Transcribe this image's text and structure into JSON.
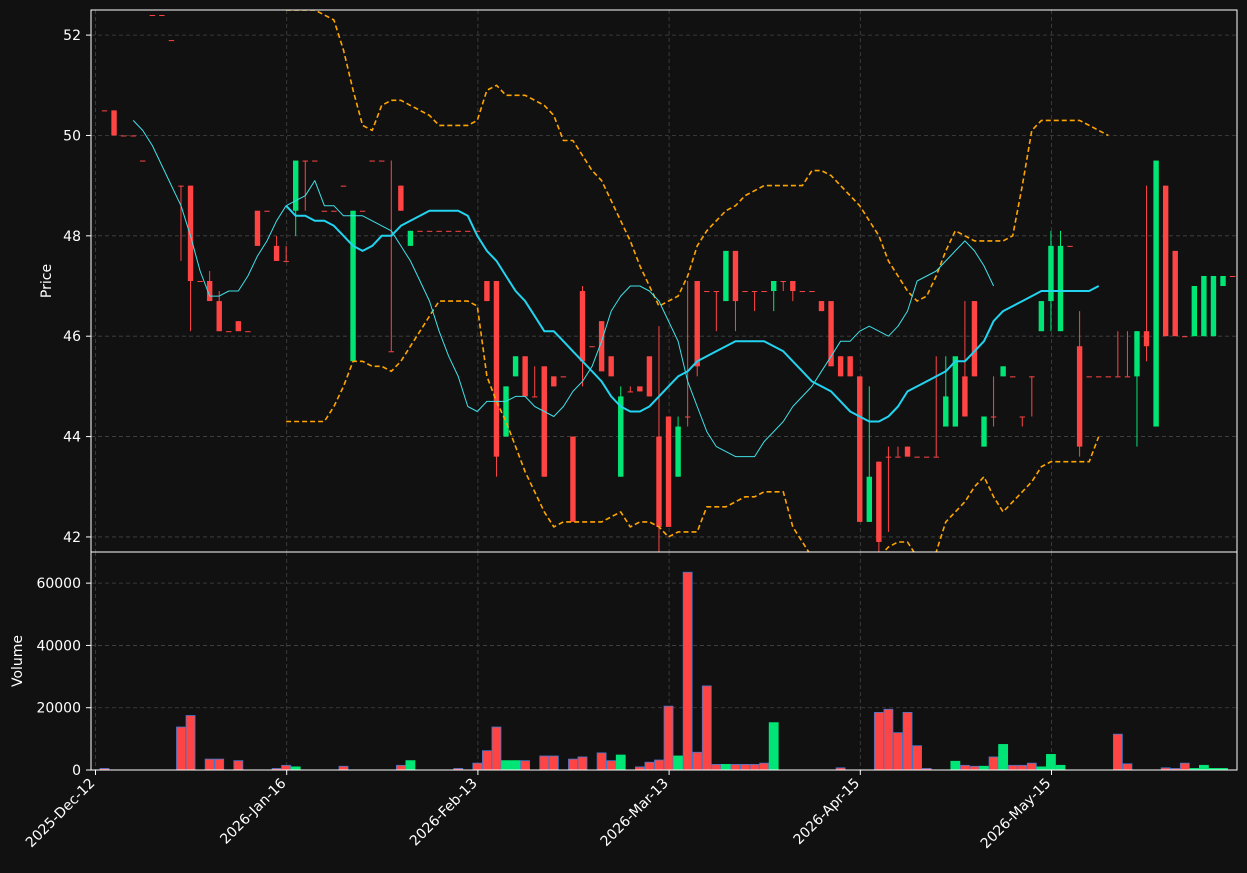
{
  "chart_data": {
    "type": "candlestick",
    "price_axis": {
      "label": "Price",
      "ylim": [
        41.7,
        52.5
      ],
      "ticks": [
        42,
        44,
        46,
        48,
        50,
        52
      ]
    },
    "volume_axis": {
      "label": "Volume",
      "ylim": [
        0,
        70000
      ],
      "ticks": [
        0,
        20000,
        40000,
        60000
      ]
    },
    "x_tick_labels": [
      "2025-Dec-12",
      "2026-Jan-16",
      "2026-Feb-13",
      "2026-Mar-13",
      "2026-Apr-15",
      "2026-May-15"
    ],
    "x_tick_index": [
      0,
      20,
      40,
      60,
      80,
      100
    ],
    "grid": true,
    "colors": {
      "background": "#111111",
      "up": "#00e676",
      "down": "#ff4444",
      "bollinger": "#ffa500",
      "ma_fast": "#40e0e8",
      "ma_slow": "#22d4f0",
      "volume_edge": "#4477cc"
    },
    "series": [
      {
        "name": "Candles",
        "open": [
          50.5,
          50.5,
          50.0,
          50.0,
          49.5,
          52.4,
          52.4,
          51.9,
          49.0,
          49.0,
          47.1,
          47.1,
          46.7,
          46.1,
          46.3,
          46.1,
          48.5,
          48.5,
          47.8,
          47.5,
          48.5,
          49.5,
          49.5,
          48.5,
          48.5,
          49.0,
          45.5,
          48.5,
          49.5,
          49.5,
          45.7,
          49.0,
          47.8,
          48.1,
          48.1,
          48.1,
          48.1,
          48.1,
          48.1,
          48.1,
          47.1,
          47.1,
          44.0,
          45.2,
          45.6,
          44.8,
          45.4,
          45.2,
          45.2,
          44.0,
          46.9,
          45.8,
          46.3,
          45.6,
          43.2,
          44.9,
          45.0,
          45.6,
          44.0,
          44.4,
          43.2,
          44.4,
          47.1,
          46.9,
          46.9,
          46.7,
          47.7,
          46.9,
          46.9,
          46.9,
          46.9,
          47.1,
          47.1,
          46.9,
          46.9,
          46.7,
          46.7,
          45.6,
          45.6,
          45.2,
          42.3,
          43.5,
          43.6,
          43.6,
          43.8,
          43.6,
          43.6,
          43.6,
          44.2,
          44.2,
          45.2,
          46.7,
          43.8,
          44.4,
          45.2,
          45.2,
          44.4,
          45.2,
          46.1,
          46.7,
          46.1,
          47.8,
          45.8,
          45.2,
          45.2,
          45.2,
          45.2,
          45.2,
          45.2,
          46.1,
          44.2,
          49.0,
          47.7,
          46.0,
          46.0,
          46.0,
          46.0,
          47.0,
          47.2,
          47.2,
          47.2,
          47.2,
          47.2,
          47.0,
          47.0
        ],
        "high": [
          50.5,
          50.5,
          50.0,
          50.0,
          49.5,
          52.4,
          52.4,
          51.9,
          49.0,
          49.0,
          47.1,
          47.3,
          46.9,
          46.1,
          46.3,
          46.1,
          48.5,
          48.5,
          48.0,
          47.8,
          49.5,
          49.5,
          49.5,
          48.5,
          48.5,
          49.0,
          48.5,
          48.5,
          49.5,
          49.5,
          49.5,
          49.0,
          48.1,
          48.1,
          48.1,
          48.1,
          48.1,
          48.1,
          48.1,
          48.1,
          47.1,
          47.1,
          45.0,
          45.6,
          45.6,
          45.4,
          45.4,
          45.2,
          45.2,
          44.0,
          47.0,
          45.8,
          46.3,
          45.6,
          45.0,
          45.0,
          45.0,
          45.6,
          46.2,
          44.4,
          44.4,
          47.1,
          47.1,
          46.9,
          46.9,
          47.7,
          47.7,
          46.9,
          46.9,
          46.9,
          46.9,
          47.1,
          47.1,
          46.9,
          46.9,
          46.7,
          46.7,
          45.6,
          45.6,
          45.2,
          45.0,
          43.5,
          43.8,
          43.8,
          43.8,
          43.6,
          43.6,
          45.6,
          45.6,
          45.2,
          46.7,
          46.7,
          44.4,
          45.2,
          45.4,
          45.2,
          44.4,
          45.2,
          46.7,
          48.1,
          48.1,
          47.8,
          46.5,
          45.2,
          45.2,
          45.2,
          46.1,
          46.1,
          46.1,
          49.0,
          49.5,
          46.0,
          46.0,
          46.0,
          46.0,
          47.2,
          47.2,
          47.2,
          47.2,
          47.2,
          47.2,
          47.0,
          47.0
        ],
        "low": [
          50.5,
          50.0,
          50.0,
          50.0,
          49.5,
          52.4,
          52.4,
          51.9,
          47.5,
          46.1,
          47.1,
          46.9,
          46.1,
          46.1,
          46.1,
          46.1,
          47.8,
          48.5,
          47.5,
          47.5,
          48.0,
          48.5,
          49.5,
          48.5,
          48.5,
          49.0,
          45.5,
          48.5,
          49.5,
          49.5,
          45.7,
          48.5,
          47.8,
          48.1,
          48.1,
          48.1,
          48.1,
          48.1,
          48.1,
          48.1,
          46.7,
          43.2,
          44.0,
          45.2,
          44.8,
          44.8,
          43.2,
          45.0,
          45.2,
          42.3,
          45.0,
          45.8,
          45.3,
          45.2,
          43.2,
          44.9,
          44.9,
          44.8,
          41.7,
          42.2,
          43.2,
          44.2,
          45.2,
          46.9,
          46.1,
          46.7,
          46.1,
          46.9,
          46.5,
          46.9,
          46.5,
          46.9,
          46.7,
          46.9,
          46.9,
          46.5,
          46.7,
          45.2,
          45.2,
          42.3,
          42.3,
          41.7,
          42.1,
          43.6,
          43.6,
          43.6,
          43.6,
          43.6,
          44.2,
          44.2,
          45.2,
          45.2,
          43.8,
          44.2,
          45.2,
          45.2,
          44.2,
          44.4,
          46.1,
          46.1,
          46.1,
          47.8,
          43.6,
          45.2,
          45.2,
          45.2,
          45.2,
          45.2,
          43.8,
          45.5,
          47.7,
          46.0,
          46.0,
          46.0,
          46.0,
          47.0,
          47.0,
          47.2,
          47.2,
          47.2,
          47.0,
          46.9,
          47.0
        ],
        "close": [
          50.5,
          50.0,
          50.0,
          50.0,
          49.5,
          52.4,
          52.4,
          51.9,
          49.0,
          47.1,
          47.1,
          46.7,
          46.1,
          46.1,
          46.1,
          46.1,
          47.8,
          48.5,
          47.5,
          47.5,
          49.5,
          49.5,
          49.5,
          48.5,
          48.5,
          49.0,
          48.5,
          48.5,
          49.5,
          49.5,
          45.7,
          48.5,
          48.1,
          48.1,
          48.1,
          48.1,
          48.1,
          48.1,
          48.1,
          48.1,
          46.7,
          43.6,
          45.0,
          45.6,
          44.8,
          44.8,
          43.2,
          45.0,
          45.2,
          42.3,
          45.5,
          45.8,
          45.3,
          45.2,
          44.8,
          44.9,
          44.9,
          44.8,
          42.2,
          42.2,
          44.2,
          44.4,
          45.4,
          46.9,
          46.9,
          47.7,
          46.7,
          46.9,
          46.9,
          46.9,
          47.1,
          47.1,
          46.9,
          46.9,
          46.9,
          46.5,
          45.4,
          45.2,
          45.2,
          42.3,
          43.2,
          41.9,
          43.6,
          43.6,
          43.6,
          43.6,
          43.6,
          43.6,
          44.8,
          45.6,
          44.4,
          45.2,
          44.4,
          44.4,
          45.4,
          45.2,
          44.4,
          45.2,
          46.7,
          47.8,
          47.8,
          47.8,
          43.8,
          45.2,
          45.2,
          45.2,
          45.2,
          45.2,
          46.1,
          45.8,
          49.5,
          46.0,
          46.0,
          46.0,
          47.0,
          47.2,
          47.2,
          47.2,
          47.2,
          47.0,
          47.0,
          47.0,
          47.0
        ]
      },
      {
        "name": "Volume",
        "values": [
          500,
          0,
          0,
          0,
          0,
          0,
          0,
          0,
          13800,
          17500,
          0,
          3500,
          3500,
          0,
          3000,
          0,
          0,
          0,
          500,
          1500,
          1000,
          0,
          0,
          0,
          0,
          1200,
          0,
          0,
          0,
          0,
          0,
          1500,
          3000,
          0,
          0,
          0,
          0,
          500,
          0,
          2200,
          6200,
          13800,
          3000,
          3000,
          3000,
          0,
          4500,
          4500,
          0,
          3500,
          4200,
          0,
          5500,
          3000,
          4800,
          0,
          1000,
          2500,
          3200,
          20500,
          4500,
          63500,
          5700,
          27000,
          1800,
          1800,
          1800,
          1800,
          1800,
          2200,
          15200,
          0,
          0,
          0,
          0,
          0,
          0,
          700,
          0,
          0,
          0,
          18500,
          19500,
          12000,
          18500,
          7800,
          500,
          0,
          0,
          2800,
          1500,
          1200,
          1200,
          4200,
          8200,
          1500,
          1500,
          2200,
          1000,
          5000,
          1500,
          0,
          0,
          0,
          0,
          0,
          11500,
          2000,
          0,
          0,
          0,
          700,
          500,
          2200,
          500,
          1500,
          500,
          500,
          0,
          0,
          0,
          1200,
          0,
          500,
          500,
          500,
          0,
          500,
          0,
          500
        ]
      },
      {
        "name": "Bollinger upper",
        "start": 19,
        "values": [
          52.5,
          52.5,
          52.5,
          52.5,
          52.4,
          52.3,
          51.7,
          50.9,
          50.2,
          50.1,
          50.6,
          50.7,
          50.7,
          50.6,
          50.5,
          50.4,
          50.2,
          50.2,
          50.2,
          50.2,
          50.3,
          50.9,
          51.0,
          50.8,
          50.8,
          50.8,
          50.7,
          50.6,
          50.4,
          49.9,
          49.9,
          49.6,
          49.3,
          49.1,
          48.7,
          48.3,
          47.9,
          47.4,
          47.0,
          46.6,
          46.7,
          46.8,
          47.2,
          47.8,
          48.1,
          48.3,
          48.5,
          48.6,
          48.8,
          48.9,
          49.0,
          49.0,
          49.0,
          49.0,
          49.0,
          49.3,
          49.3,
          49.2,
          49.0,
          48.8,
          48.6,
          48.3,
          48.0,
          47.5,
          47.2,
          46.9,
          46.7,
          46.8,
          47.2,
          47.7,
          48.1,
          48.0,
          47.9,
          47.9,
          47.9,
          47.9,
          48.0,
          49.0,
          50.1,
          50.3,
          50.3,
          50.3,
          50.3,
          50.3,
          50.2,
          50.1,
          50.0
        ]
      },
      {
        "name": "Bollinger lower",
        "start": 19,
        "values": [
          44.3,
          44.3,
          44.3,
          44.3,
          44.3,
          44.6,
          45.0,
          45.5,
          45.5,
          45.4,
          45.4,
          45.3,
          45.5,
          45.8,
          46.1,
          46.4,
          46.7,
          46.7,
          46.7,
          46.7,
          46.6,
          45.2,
          44.7,
          44.3,
          43.8,
          43.3,
          42.9,
          42.5,
          42.2,
          42.3,
          42.3,
          42.3,
          42.3,
          42.3,
          42.4,
          42.5,
          42.2,
          42.3,
          42.3,
          42.2,
          42.0,
          42.1,
          42.1,
          42.1,
          42.6,
          42.6,
          42.6,
          42.7,
          42.8,
          42.8,
          42.9,
          42.9,
          42.9,
          42.2,
          41.9,
          41.6,
          41.5,
          41.5,
          41.5,
          41.5,
          41.5,
          41.5,
          41.6,
          41.8,
          41.9,
          41.9,
          41.6,
          41.3,
          41.7,
          42.3,
          42.5,
          42.7,
          43.0,
          43.2,
          42.8,
          42.5,
          42.7,
          42.9,
          43.1,
          43.4,
          43.5,
          43.5,
          43.5,
          43.5,
          43.5,
          44.0
        ]
      },
      {
        "name": "MA slow",
        "start": 19,
        "values": [
          48.6,
          48.4,
          48.4,
          48.3,
          48.3,
          48.2,
          48.0,
          47.8,
          47.7,
          47.8,
          48.0,
          48.0,
          48.2,
          48.3,
          48.4,
          48.5,
          48.5,
          48.5,
          48.5,
          48.4,
          48.0,
          47.7,
          47.5,
          47.2,
          46.9,
          46.7,
          46.4,
          46.1,
          46.1,
          45.9,
          45.7,
          45.5,
          45.3,
          45.1,
          44.8,
          44.6,
          44.5,
          44.5,
          44.6,
          44.8,
          45.0,
          45.2,
          45.3,
          45.5,
          45.6,
          45.7,
          45.8,
          45.9,
          45.9,
          45.9,
          45.9,
          45.8,
          45.7,
          45.5,
          45.3,
          45.1,
          45.0,
          44.9,
          44.7,
          44.5,
          44.4,
          44.3,
          44.3,
          44.4,
          44.6,
          44.9,
          45.0,
          45.1,
          45.2,
          45.3,
          45.5,
          45.5,
          45.7,
          45.9,
          46.3,
          46.5,
          46.6,
          46.7,
          46.8,
          46.9,
          46.9,
          46.9,
          46.9,
          46.9,
          46.9,
          47.0
        ]
      },
      {
        "name": "MA fast",
        "start": 3,
        "values": [
          50.3,
          50.1,
          49.8,
          49.4,
          49.0,
          48.6,
          48.0,
          47.3,
          46.8,
          46.8,
          46.9,
          46.9,
          47.2,
          47.6,
          47.9,
          48.3,
          48.6,
          48.7,
          48.8,
          49.1,
          48.6,
          48.6,
          48.4,
          48.4,
          48.4,
          48.3,
          48.2,
          48.1,
          47.8,
          47.5,
          47.1,
          46.7,
          46.1,
          45.6,
          45.2,
          44.6,
          44.5,
          44.7,
          44.7,
          44.7,
          44.8,
          44.8,
          44.6,
          44.5,
          44.4,
          44.6,
          44.9,
          45.1,
          45.4,
          45.9,
          46.5,
          46.8,
          47.0,
          47.0,
          46.9,
          46.7,
          46.3,
          45.9,
          45.1,
          44.6,
          44.1,
          43.8,
          43.7,
          43.6,
          43.6,
          43.6,
          43.9,
          44.1,
          44.3,
          44.6,
          44.8,
          45.0,
          45.3,
          45.6,
          45.9,
          45.9,
          46.1,
          46.2,
          46.1,
          46.0,
          46.2,
          46.5,
          47.1,
          47.2,
          47.3,
          47.5,
          47.7,
          47.9,
          47.7,
          47.4,
          47.0
        ]
      }
    ]
  }
}
